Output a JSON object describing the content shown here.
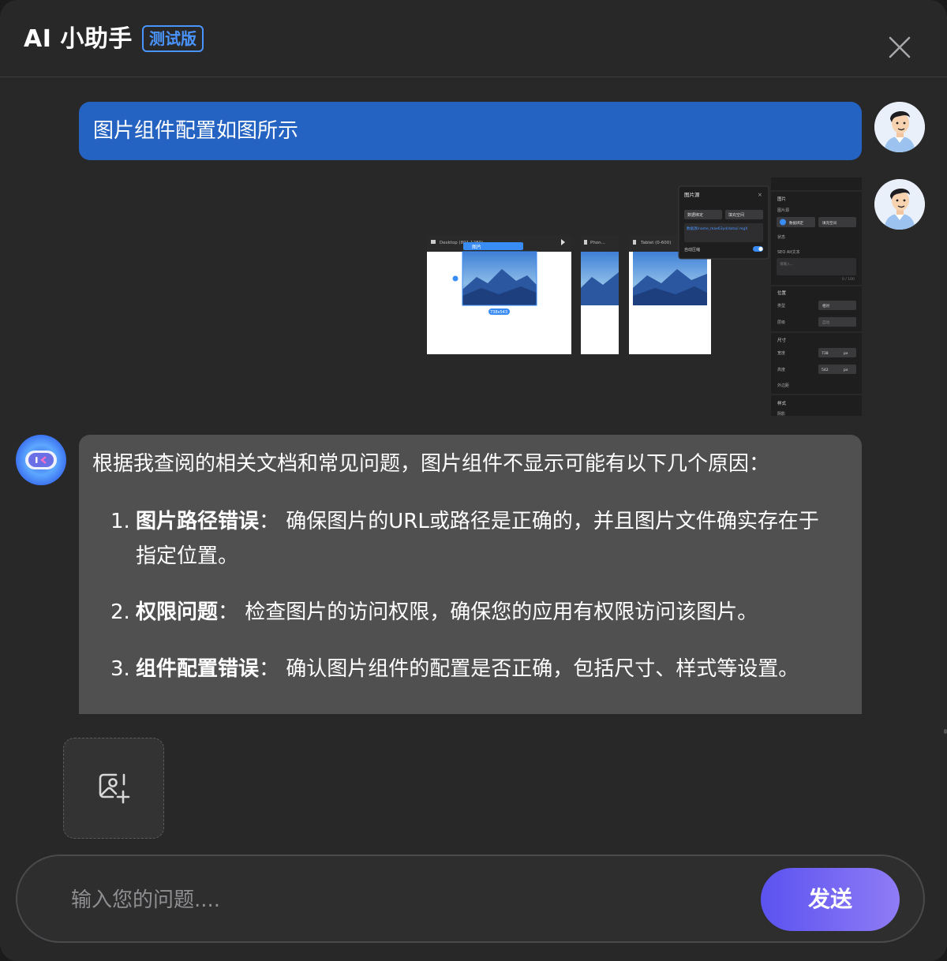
{
  "header": {
    "title": "AI 小助手",
    "badge": "测试版"
  },
  "messages": {
    "user_text": "图片组件配置如图所示",
    "bot": {
      "intro": "根据我查阅的相关文档和常见问题，图片组件不显示可能有以下几个原因：",
      "items": [
        {
          "num": "1.",
          "title": "图片路径错误",
          "sep": "： ",
          "text": "确保图片的URL或路径是正确的，并且图片文件确实存在于指定位置。"
        },
        {
          "num": "2.",
          "title": "权限问题",
          "sep": "： ",
          "text": "检查图片的访问权限，确保您的应用有权限访问该图片。"
        },
        {
          "num": "3.",
          "title": "组件配置错误",
          "sep": "： ",
          "text": "确认图片组件的配置是否正确，包括尺寸、样式等设置。"
        }
      ]
    }
  },
  "screenshot": {
    "tabs": [
      "Desktop (801-1280)",
      "Phon...",
      "Tablet (0-600)"
    ],
    "selected_size": "738x543",
    "toolbar_label": "图片",
    "popup": {
      "title": "图片源",
      "select_binding": "数据绑定",
      "select_fill": "填充空间",
      "path_text": "数据源/name_mae63yd/data/i mgX",
      "auto_compress": "自动压缩"
    },
    "props": {
      "section_image": "图片",
      "image_source": "图片源",
      "binding_btn": "数据绑定",
      "fill_btn": "填充空间",
      "state": "状态",
      "seo_alt": "SEO Alt文本",
      "alt_placeholder": "请输入...",
      "alt_count": "0 / 100",
      "section_position": "位置",
      "type_label": "类型",
      "type_value": "相对",
      "layer_label": "层级",
      "layer_value": "自动",
      "section_size": "尺寸",
      "width_label": "宽度",
      "width_value": "738",
      "height_label": "高度",
      "height_value": "542",
      "unit": "px",
      "margin_label": "外边距",
      "section_style": "样式",
      "shadow_label": "阴影"
    }
  },
  "upload": {
    "icon": "image-add-icon"
  },
  "composer": {
    "placeholder": "输入您的问题....",
    "send_label": "发送"
  },
  "colors": {
    "panel_bg": "#282829",
    "user_bubble": "#2563c3",
    "bot_bubble": "#505050",
    "badge": "#4a94ff",
    "send_gradient_start": "#5b52f0",
    "send_gradient_end": "#8f7cf5"
  }
}
